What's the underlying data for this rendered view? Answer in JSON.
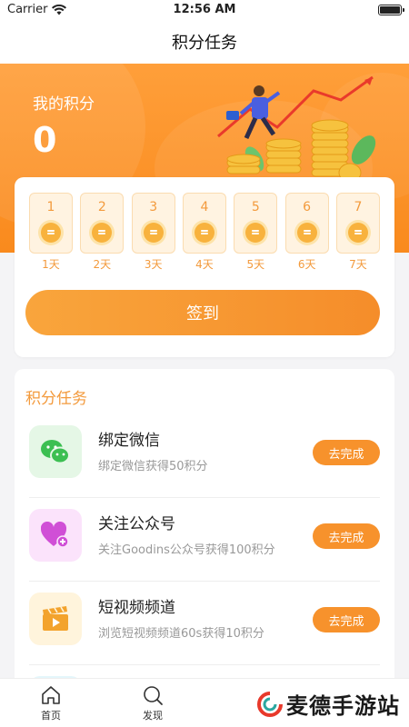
{
  "status_bar": {
    "carrier": "Carrier",
    "time": "12:56 AM"
  },
  "nav": {
    "title": "积分任务"
  },
  "hero": {
    "label": "我的积分",
    "points": "0"
  },
  "checkin": {
    "days": [
      {
        "num": "1",
        "label": "1天"
      },
      {
        "num": "2",
        "label": "2天"
      },
      {
        "num": "3",
        "label": "3天"
      },
      {
        "num": "4",
        "label": "4天"
      },
      {
        "num": "5",
        "label": "5天"
      },
      {
        "num": "6",
        "label": "6天"
      },
      {
        "num": "7",
        "label": "7天"
      }
    ],
    "button_label": "签到"
  },
  "tasks": {
    "section_title": "积分任务",
    "items": [
      {
        "name": "绑定微信",
        "desc": "绑定微信获得50积分",
        "button": "去完成",
        "icon": "wechat-icon",
        "icon_bg": "#e5f7e6",
        "icon_color": "#3cbf52"
      },
      {
        "name": "关注公众号",
        "desc": "关注Goodins公众号获得100积分",
        "button": "去完成",
        "icon": "heart-plus-icon",
        "icon_bg": "#fbe3fb",
        "icon_color": "#d04fd6"
      },
      {
        "name": "短视频频道",
        "desc": "浏览短视频频道60s获得10积分",
        "button": "去完成",
        "icon": "video-clapper-icon",
        "icon_bg": "#fff4dc",
        "icon_color": "#f3a32d"
      }
    ]
  },
  "tab_bar": {
    "tabs": [
      {
        "label": "首页",
        "icon": "home-icon"
      },
      {
        "label": "发现",
        "icon": "search-icon"
      }
    ]
  },
  "watermark": {
    "text": "麦德手游站"
  },
  "colors": {
    "accent": "#f7922c",
    "hero": "#ff9f3a"
  }
}
